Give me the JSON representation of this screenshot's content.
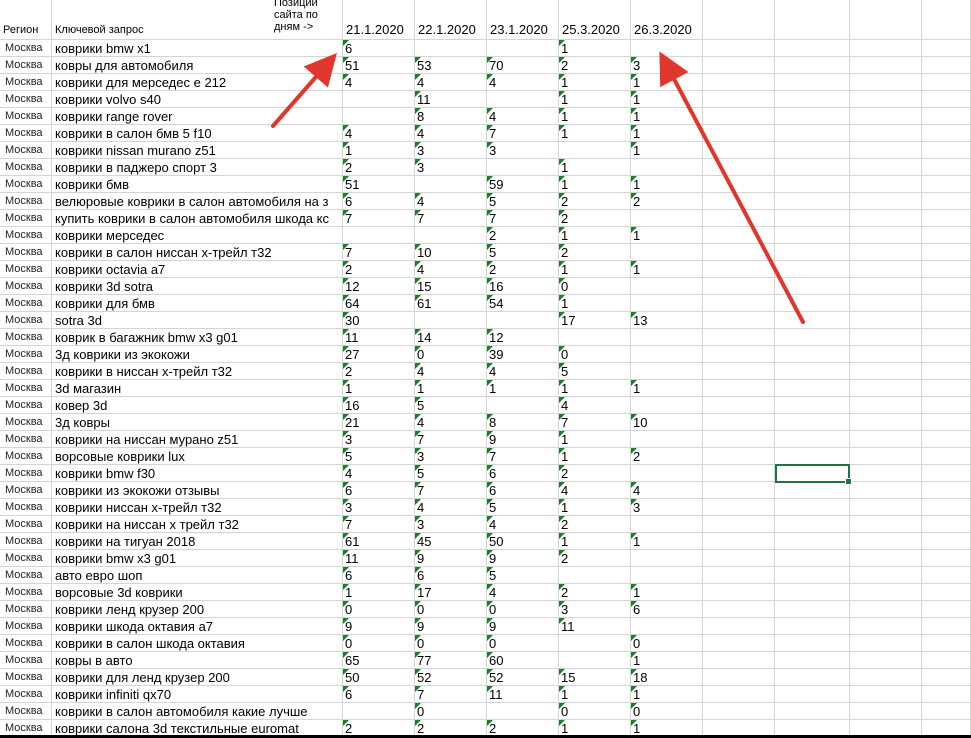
{
  "header": {
    "region": "Регион",
    "keyword": "Ключевой запрос",
    "positions": "Позиции сайта по дням ->",
    "dates": [
      "21.1.2020",
      "22.1.2020",
      "23.1.2020",
      "25.3.2020",
      "26.3.2020"
    ]
  },
  "rows": [
    {
      "region": "Москва",
      "keyword": "коврики bmw x1",
      "v": [
        "6",
        "",
        "",
        "1",
        ""
      ]
    },
    {
      "region": "Москва",
      "keyword": "ковры для автомобиля",
      "v": [
        "51",
        "53",
        "70",
        "2",
        "3"
      ]
    },
    {
      "region": "Москва",
      "keyword": "коврики для мерседес е 212",
      "v": [
        "4",
        "4",
        "4",
        "1",
        "1"
      ]
    },
    {
      "region": "Москва",
      "keyword": "коврики volvo s40",
      "v": [
        "",
        "11",
        "",
        "1",
        "1"
      ]
    },
    {
      "region": "Москва",
      "keyword": "коврики range rover",
      "v": [
        "",
        "8",
        "4",
        "1",
        "1"
      ]
    },
    {
      "region": "Москва",
      "keyword": "коврики в салон бмв 5 f10",
      "v": [
        "4",
        "4",
        "7",
        "1",
        "1"
      ]
    },
    {
      "region": "Москва",
      "keyword": "коврики nissan murano z51",
      "v": [
        "1",
        "3",
        "3",
        "",
        "1"
      ]
    },
    {
      "region": "Москва",
      "keyword": "коврики в паджеро спорт 3",
      "v": [
        "2",
        "3",
        "",
        "1",
        ""
      ]
    },
    {
      "region": "Москва",
      "keyword": "коврики бмв",
      "v": [
        "51",
        "",
        "59",
        "1",
        "1"
      ]
    },
    {
      "region": "Москва",
      "keyword": "велюровые коврики в салон автомобиля на з",
      "v": [
        "6",
        "4",
        "5",
        "2",
        "2"
      ]
    },
    {
      "region": "Москва",
      "keyword": "купить коврики в салон автомобиля шкода кс",
      "v": [
        "7",
        "7",
        "7",
        "2",
        ""
      ]
    },
    {
      "region": "Москва",
      "keyword": "коврики мерседес",
      "v": [
        "",
        "",
        "2",
        "1",
        "1"
      ]
    },
    {
      "region": "Москва",
      "keyword": "коврики в салон ниссан х-трейл т32",
      "v": [
        "7",
        "10",
        "5",
        "2",
        ""
      ]
    },
    {
      "region": "Москва",
      "keyword": "коврики octavia a7",
      "v": [
        "2",
        "4",
        "2",
        "1",
        "1"
      ]
    },
    {
      "region": "Москва",
      "keyword": "коврики 3d sotra",
      "v": [
        "12",
        "15",
        "16",
        "0",
        ""
      ]
    },
    {
      "region": "Москва",
      "keyword": "коврики для бмв",
      "v": [
        "64",
        "61",
        "54",
        "1",
        ""
      ]
    },
    {
      "region": "Москва",
      "keyword": "sotra 3d",
      "v": [
        "30",
        "",
        "",
        "17",
        "13"
      ]
    },
    {
      "region": "Москва",
      "keyword": "коврик в багажник bmw x3 g01",
      "v": [
        "11",
        "14",
        "12",
        "",
        ""
      ]
    },
    {
      "region": "Москва",
      "keyword": "3д коврики из экокожи",
      "v": [
        "27",
        "0",
        "39",
        "0",
        ""
      ]
    },
    {
      "region": "Москва",
      "keyword": "коврики в ниссан х-трейл т32",
      "v": [
        "2",
        "4",
        "4",
        "5",
        ""
      ]
    },
    {
      "region": "Москва",
      "keyword": "3d магазин",
      "v": [
        "1",
        "1",
        "1",
        "1",
        "1"
      ]
    },
    {
      "region": "Москва",
      "keyword": "ковер 3d",
      "v": [
        "16",
        "5",
        "",
        "4",
        ""
      ]
    },
    {
      "region": "Москва",
      "keyword": "3д ковры",
      "v": [
        "21",
        "4",
        "8",
        "7",
        "10"
      ]
    },
    {
      "region": "Москва",
      "keyword": "коврики на ниссан мурано z51",
      "v": [
        "3",
        "7",
        "9",
        "1",
        ""
      ]
    },
    {
      "region": "Москва",
      "keyword": "ворсовые коврики lux",
      "v": [
        "5",
        "3",
        "7",
        "1",
        "2"
      ]
    },
    {
      "region": "Москва",
      "keyword": "коврики bmw f30",
      "v": [
        "4",
        "5",
        "6",
        "2",
        ""
      ]
    },
    {
      "region": "Москва",
      "keyword": "коврики из экокожи отзывы",
      "v": [
        "6",
        "7",
        "6",
        "4",
        "4"
      ]
    },
    {
      "region": "Москва",
      "keyword": "коврики ниссан х-трейл т32",
      "v": [
        "3",
        "4",
        "5",
        "1",
        "3"
      ]
    },
    {
      "region": "Москва",
      "keyword": "коврики на ниссан х трейл т32",
      "v": [
        "7",
        "3",
        "4",
        "2",
        ""
      ]
    },
    {
      "region": "Москва",
      "keyword": "коврики на тигуан 2018",
      "v": [
        "61",
        "45",
        "50",
        "1",
        "1"
      ]
    },
    {
      "region": "Москва",
      "keyword": "коврики bmw x3 g01",
      "v": [
        "11",
        "9",
        "9",
        "2",
        ""
      ]
    },
    {
      "region": "Москва",
      "keyword": "авто евро шоп",
      "v": [
        "6",
        "6",
        "5",
        "",
        ""
      ]
    },
    {
      "region": "Москва",
      "keyword": "ворсовые 3d коврики",
      "v": [
        "1",
        "17",
        "4",
        "2",
        "1"
      ]
    },
    {
      "region": "Москва",
      "keyword": "коврики ленд крузер 200",
      "v": [
        "0",
        "0",
        "0",
        "3",
        "6"
      ]
    },
    {
      "region": "Москва",
      "keyword": "коврики шкода октавия а7",
      "v": [
        "9",
        "9",
        "9",
        "11",
        ""
      ]
    },
    {
      "region": "Москва",
      "keyword": "коврики в салон шкода октавия",
      "v": [
        "0",
        "0",
        "0",
        "",
        "0"
      ]
    },
    {
      "region": "Москва",
      "keyword": "ковры в авто",
      "v": [
        "65",
        "77",
        "60",
        "",
        "1"
      ]
    },
    {
      "region": "Москва",
      "keyword": "коврики для ленд крузер 200",
      "v": [
        "50",
        "52",
        "52",
        "15",
        "18"
      ]
    },
    {
      "region": "Москва",
      "keyword": "коврики infiniti qx70",
      "v": [
        "6",
        "7",
        "11",
        "1",
        "1"
      ]
    },
    {
      "region": "Москва",
      "keyword": "коврики в салон автомобиля какие лучше",
      "v": [
        "",
        "0",
        "",
        "0",
        "0"
      ]
    },
    {
      "region": "Москва",
      "keyword": "коврики салона 3d текстильные euromat",
      "v": [
        "2",
        "2",
        "2",
        "1",
        "1"
      ]
    }
  ],
  "colors": {
    "flag": "#1a7f2b",
    "arrow": "#e0362b",
    "selection": "#217346",
    "gridline": "#d4d4d4"
  }
}
